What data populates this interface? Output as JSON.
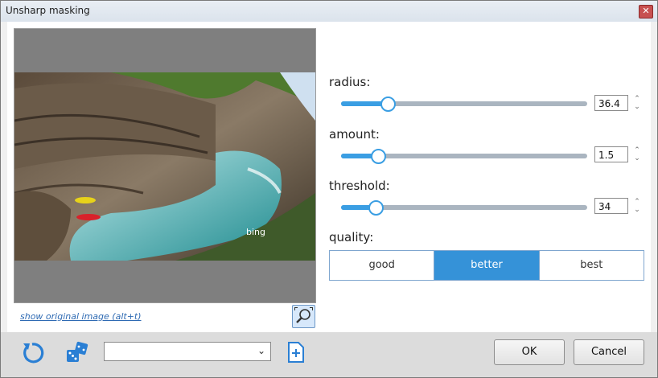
{
  "window": {
    "title": "Unsharp masking"
  },
  "preview": {
    "watermark": "bing",
    "show_original_label": "show original image (alt+t)"
  },
  "controls": {
    "radius": {
      "label": "radius:",
      "value": "36.4",
      "fraction": 0.19
    },
    "amount": {
      "label": "amount:",
      "value": "1.5",
      "fraction": 0.15
    },
    "threshold": {
      "label": "threshold:",
      "value": "34",
      "fraction": 0.14
    },
    "quality": {
      "label": "quality:",
      "options": [
        "good",
        "better",
        "best"
      ],
      "selected": "better"
    }
  },
  "footer": {
    "preset_value": "",
    "ok_label": "OK",
    "cancel_label": "Cancel"
  },
  "colors": {
    "accent": "#3592d8",
    "slider_fill": "#3a9ee3"
  }
}
